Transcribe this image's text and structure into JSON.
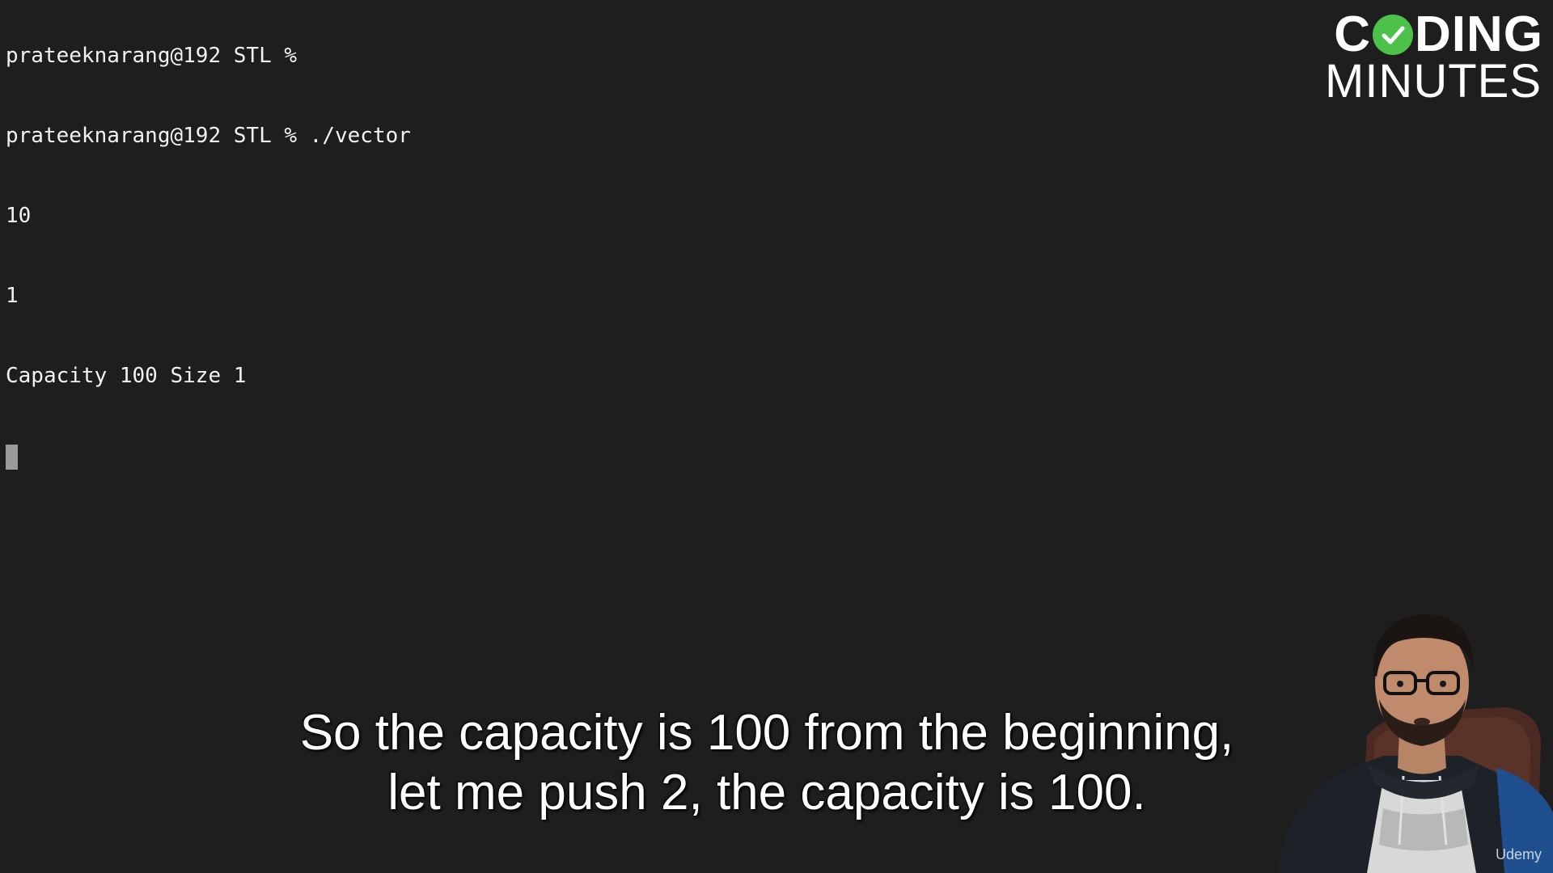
{
  "terminal": {
    "lines": [
      "prateeknarang@192 STL %",
      "prateeknarang@192 STL % ./vector",
      "10",
      "1",
      "Capacity 100 Size 1"
    ]
  },
  "logo": {
    "top_prefix": "C",
    "top_suffix": "DING",
    "bottom": "MINUTES",
    "accent_color": "#4cc24a"
  },
  "subtitles": {
    "line1": "So the capacity is 100 from the beginning,",
    "line2": "let me push 2, the capacity is 100."
  },
  "watermark": {
    "text": "Udemy"
  },
  "colors": {
    "background": "#1e1e1e",
    "text": "#f2f2f2",
    "cursor": "#9a9a9a"
  }
}
